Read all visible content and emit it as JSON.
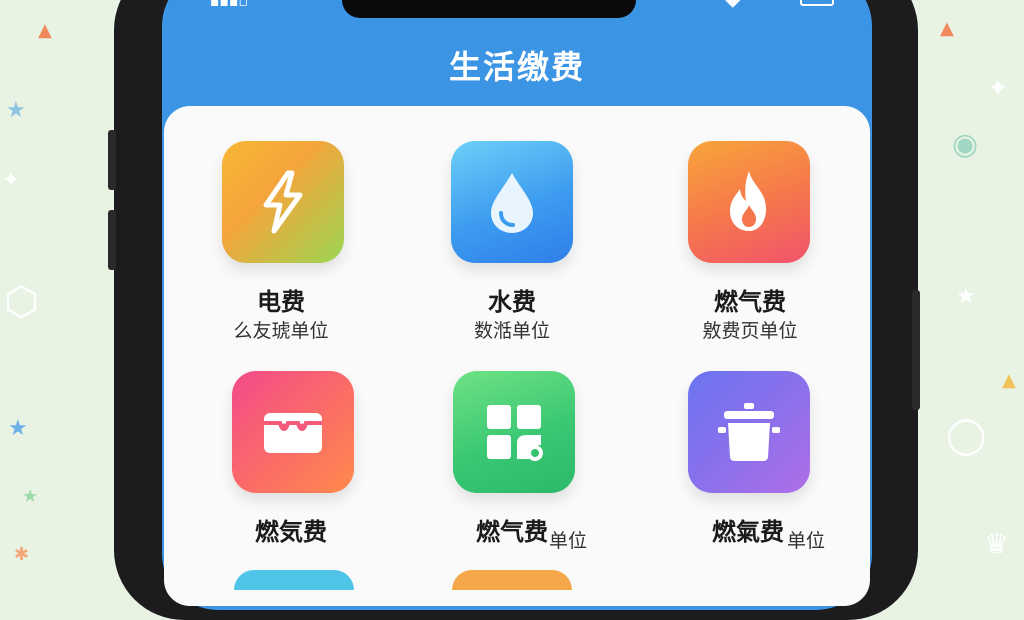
{
  "header": {
    "title": "生活缴费"
  },
  "services": [
    {
      "name": "电费",
      "subtitle": "么友琥单位",
      "icon": "lightning-bolt-icon",
      "gradient": [
        "#f7b733",
        "#9bd652"
      ]
    },
    {
      "name": "水费",
      "subtitle": "数湉单位",
      "icon": "water-drop-icon",
      "gradient": [
        "#5cc4f5",
        "#2f7fe8"
      ]
    },
    {
      "name": "燃气费",
      "subtitle": "敫费页单位",
      "icon": "flame-icon",
      "gradient": [
        "#f9a53a",
        "#f2536c"
      ]
    },
    {
      "name": "燃気费",
      "subtitle": "",
      "icon": "card-holder-icon",
      "gradient": [
        "#f24a8a",
        "#ff8a4c"
      ]
    },
    {
      "name": "燃气费",
      "subtitle": "单位",
      "icon": "grid-window-icon",
      "gradient": [
        "#5edc79",
        "#2bb96a"
      ]
    },
    {
      "name": "燃氣费",
      "subtitle": "单位",
      "icon": "cooking-pot-icon",
      "gradient": [
        "#6b74f0",
        "#b06ee8"
      ]
    }
  ],
  "colors": {
    "header_bg": "#3c95e4",
    "card_bg": "#fafafa",
    "page_bg": "#e8f3e4",
    "phone_frame": "#1c1c1e"
  }
}
